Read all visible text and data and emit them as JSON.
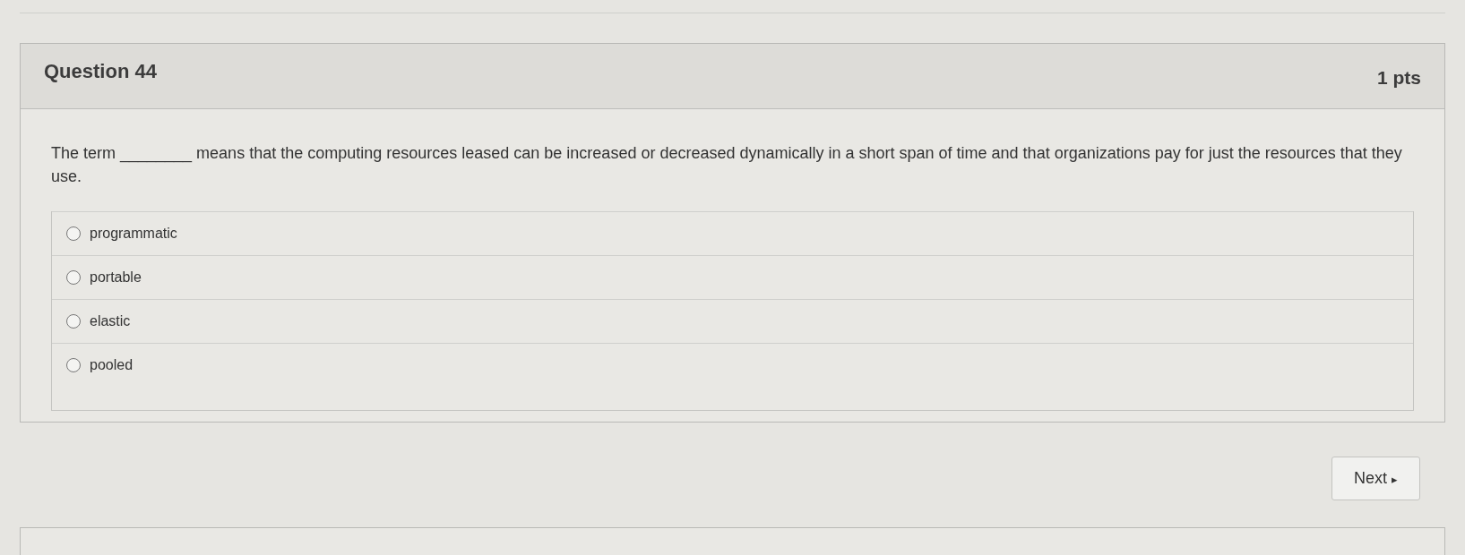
{
  "question": {
    "title": "Question 44",
    "points": "1 pts",
    "text": "The term ________ means that the computing resources leased can be increased or decreased dynamically in a short span of time and that organizations pay for just the resources that they use.",
    "options": [
      {
        "label": "programmatic",
        "selected": false
      },
      {
        "label": "portable",
        "selected": false
      },
      {
        "label": "elastic",
        "selected": false
      },
      {
        "label": "pooled",
        "selected": false
      }
    ]
  },
  "next_button": {
    "label": "Next",
    "icon": "▸"
  }
}
